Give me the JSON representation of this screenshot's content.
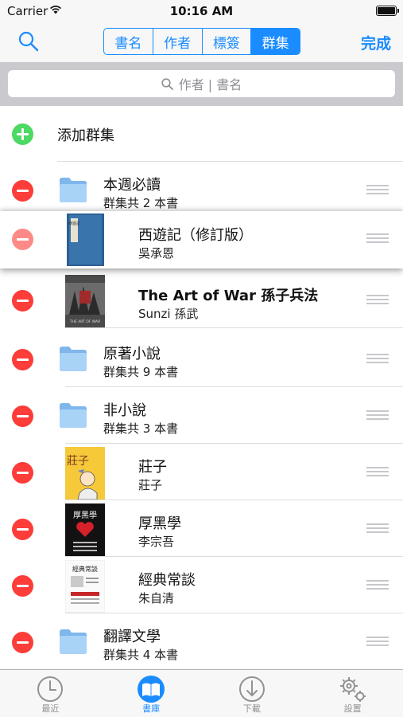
{
  "status": {
    "carrier": "Carrier",
    "time": "10:16 AM"
  },
  "nav": {
    "segments": [
      "書名",
      "作者",
      "標簽",
      "群集"
    ],
    "active_segment": 3,
    "done": "完成"
  },
  "search": {
    "placeholder": "作者 | 書名"
  },
  "add_collection": "添加群集",
  "items": [
    {
      "kind": "folder",
      "title": "本週必讀",
      "subtitle": "群集共 2 本書"
    },
    {
      "kind": "book",
      "title": "西遊記（修訂版）",
      "subtitle": "吳承恩",
      "lifted": true
    },
    {
      "kind": "book",
      "title": "The Art of War 孫子兵法",
      "subtitle": "Sunzi 孫武"
    },
    {
      "kind": "folder",
      "title": "原著小說",
      "subtitle": "群集共 9 本書"
    },
    {
      "kind": "folder",
      "title": "非小說",
      "subtitle": "群集共 3 本書"
    },
    {
      "kind": "book",
      "title": "莊子",
      "subtitle": "莊子"
    },
    {
      "kind": "book",
      "title": "厚黑學",
      "subtitle": "李宗吾"
    },
    {
      "kind": "book",
      "title": "經典常談",
      "subtitle": "朱自清"
    },
    {
      "kind": "folder",
      "title": "翻譯文學",
      "subtitle": "群集共 4 本書"
    }
  ],
  "covers": {
    "xiyouji": {
      "text": "西遊記",
      "author": "吳承恩"
    },
    "artofwar": {
      "text": "THE ART OF WAR"
    },
    "zhuangzi": {
      "text": "莊子"
    },
    "houheixue": {
      "text": "厚黑學"
    },
    "jingdian": {
      "text": "經典常談"
    }
  },
  "tabs": [
    {
      "label": "最近",
      "icon": "clock-icon"
    },
    {
      "label": "書庫",
      "icon": "book-icon",
      "active": true
    },
    {
      "label": "下載",
      "icon": "download-icon"
    },
    {
      "label": "設置",
      "icon": "gear-icon"
    }
  ],
  "colors": {
    "accent": "#1a8cff",
    "delete": "#fc3d39",
    "add": "#4cd964",
    "folder": "#8fc3f2"
  }
}
